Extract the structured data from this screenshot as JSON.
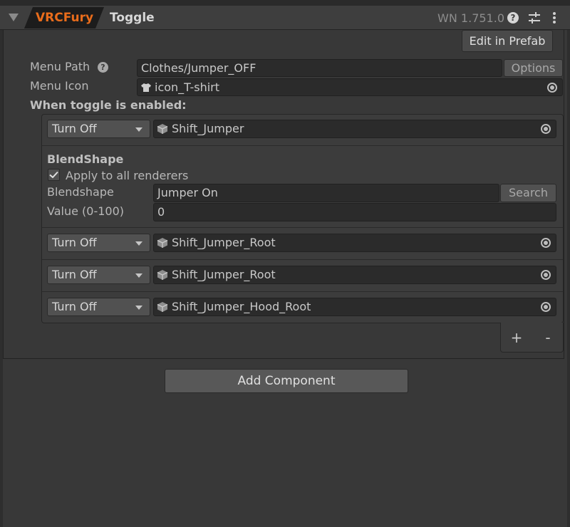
{
  "header": {
    "brand": "VRCFury",
    "title": "Toggle",
    "version": "WN 1.751.0",
    "help_icon": "?",
    "settings_icon": "sliders-icon",
    "more_icon": "kebab-icon"
  },
  "edit_prefab_label": "Edit in Prefab",
  "menu_path": {
    "label": "Menu Path",
    "help_icon": "?",
    "value": "Clothes/Jumper_OFF",
    "options_label": "Options"
  },
  "menu_icon": {
    "label": "Menu Icon",
    "value": "icon_T-shirt"
  },
  "when_enabled_label": "When toggle is enabled:",
  "actions": [
    {
      "mode": "Turn Off",
      "object": "Shift_Jumper"
    },
    {
      "mode": "Turn Off",
      "object": "Shift_Jumper_Root"
    },
    {
      "mode": "Turn Off",
      "object": "Shift_Jumper_Root"
    },
    {
      "mode": "Turn Off",
      "object": "Shift_Jumper_Hood_Root"
    }
  ],
  "blendshape": {
    "title": "BlendShape",
    "apply_all_label": "Apply to all renderers",
    "apply_all_checked": true,
    "blendshape_label": "Blendshape",
    "blendshape_value": "Jumper On",
    "search_label": "Search",
    "value_label": "Value (0-100)",
    "value": "0"
  },
  "list_footer": {
    "add": "+",
    "remove": "-"
  },
  "add_component_label": "Add Component",
  "colors": {
    "brand": "#e96c1b",
    "background": "#383838",
    "field": "#2b2b2b",
    "button": "#565656"
  }
}
